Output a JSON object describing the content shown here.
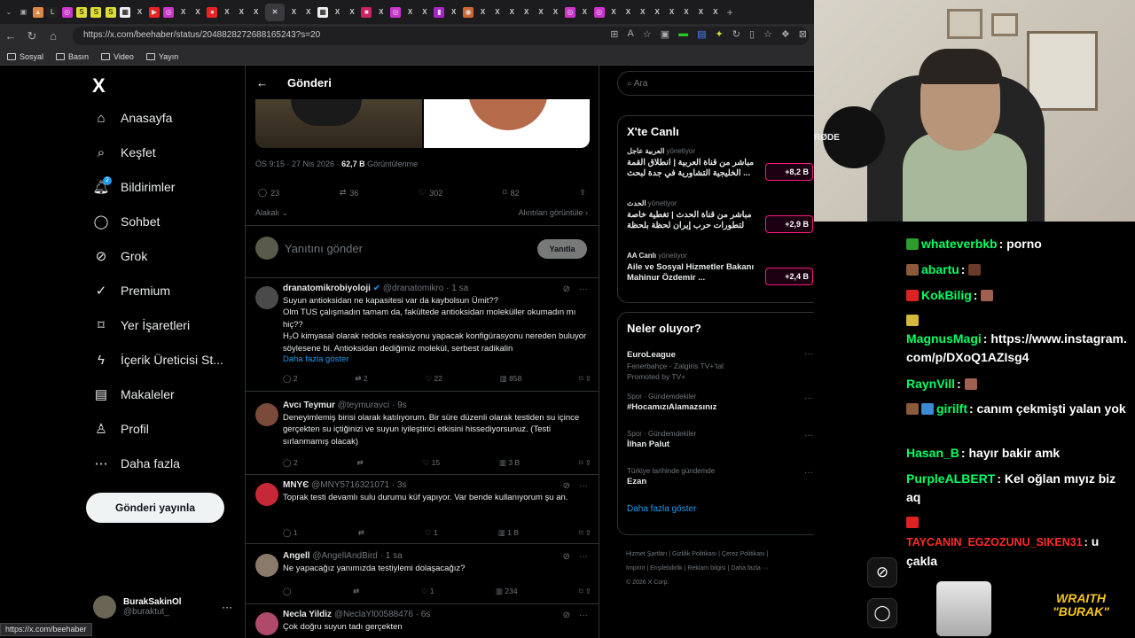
{
  "browser": {
    "url_host": "https://x.com",
    "url_path": "/beehaber/status/2048828272688165243?s=20",
    "bookmarks": [
      "Sosyal",
      "Basın",
      "Video",
      "Yayın"
    ],
    "status_url": "https://x.com/beehaber"
  },
  "nav": {
    "logo": "X",
    "items": [
      {
        "label": "Anasayfa",
        "icon": "home-icon"
      },
      {
        "label": "Keşfet",
        "icon": "search-icon"
      },
      {
        "label": "Bildirimler",
        "icon": "bell-icon",
        "badge": "2"
      },
      {
        "label": "Sohbet",
        "icon": "chat-icon"
      },
      {
        "label": "Grok",
        "icon": "grok-icon"
      },
      {
        "label": "Premium",
        "icon": "premium-icon"
      },
      {
        "label": "Yer İşaretleri",
        "icon": "bookmark-icon"
      },
      {
        "label": "İçerik Üreticisi St...",
        "icon": "lightning-icon"
      },
      {
        "label": "Makaleler",
        "icon": "article-icon"
      },
      {
        "label": "Profil",
        "icon": "person-icon"
      },
      {
        "label": "Daha fazla",
        "icon": "more-circle-icon"
      }
    ],
    "post_button": "Gönderi yayınla",
    "profile": {
      "name": "BurakSakinOl",
      "handle": "@buraktut_"
    }
  },
  "main": {
    "header": "Gönderi",
    "meta_time": "ÖS 9:15 · 27 Nis 2026 · ",
    "meta_views_value": "62,7 B",
    "meta_views_label": " Görüntülenme",
    "actions": {
      "replies": "23",
      "reposts": "36",
      "likes": "302",
      "bookmarks": "82"
    },
    "sort": "Alakalı",
    "quotes_link": "Alıntıları görüntüle",
    "reply_placeholder": "Yanıtını gönder",
    "reply_button": "Yanıtla",
    "tweets": [
      {
        "name": "dranatomikrobiyoloji",
        "handle": "@dranatomikro · 1 sa",
        "text": "Suyun antioksidan ne kapasitesi var da kaybolsun Ümit??\nOlm TUS çalışmadın tamam da, fakültede antioksidan moleküller okumadın mı hiç??\nH₂O kimyasal olarak redoks reaksiyonu yapacak konfigürasyonu nereden buluyor söylesene bi. Antioksidan dediğimiz molekül, serbest radikalin",
        "more": "Daha fazla göster",
        "replies": "2",
        "reposts": "2",
        "likes": "22",
        "views": "858"
      },
      {
        "name": "Avcı Teymur",
        "handle": "@teymuravci · 9s",
        "text": "Deneyimlemiş birisi olarak katılıyorum. Bir süre düzenli olarak testiden su içince gerçekten su içtiğinizi ve suyun iyileştirici etkisini hissediyorsunuz. (Testi sırlanmamış olacak)",
        "more": "",
        "replies": "2",
        "reposts": "",
        "likes": "15",
        "views": "3 B"
      },
      {
        "name": "MNYЄ",
        "handle": "@MNY5716321071 · 3s",
        "text": "Toprak testi devamlı sulu durumu küf yapıyor.  Var bende kullanıyorum şu an.",
        "more": "",
        "replies": "1",
        "reposts": "",
        "likes": "1",
        "views": "1 B"
      },
      {
        "name": "Angell",
        "handle": "@AngellAndBird · 1 sa",
        "text": "Ne yapacağız yanımızda testiyle​mi dolaşacağız?",
        "more": "",
        "replies": "",
        "reposts": "",
        "likes": "1",
        "views": "234"
      },
      {
        "name": "Necla Yildiz",
        "handle": "@NeclaYl00588476 · 6s",
        "text": "Çok doğru  suyun tadı  gerçekten",
        "more": "",
        "replies": "",
        "reposts": "",
        "likes": "",
        "views": ""
      }
    ]
  },
  "right": {
    "search_placeholder": "Ara",
    "live_title": "X'te Canlı",
    "live": [
      {
        "host": "العربية عاجل",
        "status": "yönetiyor",
        "title": "مباشر من قناة العربية | انطلاق القمة الخليجية التشاورية في جدة لبحث ...",
        "count": "+8,2 B"
      },
      {
        "host": "الحدث",
        "status": "yönetiyor",
        "title": "مباشر من قناة الحدث | تغطية خاصة لتطورات حرب إيران لحظة بلحظة",
        "count": "+2,9 B"
      },
      {
        "host": "AA Canlı",
        "status": "yönetiyor",
        "title": "Aile ve Sosyal Hizmetler Bakanı Mahinur Özdemir ...",
        "count": "+2,4 B"
      }
    ],
    "trends_title": "Neler oluyor?",
    "trends": [
      {
        "category": "",
        "name": "EuroLeague",
        "sub": "Fenerbahçe - Zalgiris TV+'tal",
        "promo": "Promoted by TV+"
      },
      {
        "category": "Spor · Gündemdekiler",
        "name": "#HocamızıAlamazsınız",
        "sub": "",
        "promo": ""
      },
      {
        "category": "Spor · Gündemdekiler",
        "name": "İlhan Palut",
        "sub": "",
        "promo": ""
      },
      {
        "category": "Türkiye tarihinde gündemde",
        "name": "Ezan",
        "sub": "",
        "promo": ""
      }
    ],
    "show_more": "Daha fazla göster",
    "footer": [
      "Hizmet Şartları",
      "Gizlilik Politikası",
      "Çerez Politikası",
      "Imprint",
      "Erişilebilirlik",
      "Reklam bilgisi",
      "Daha fazla ···",
      "© 2026 X Corp."
    ]
  },
  "stream": {
    "cam_label": "RØDE",
    "chat": [
      {
        "user": "whateverbkb",
        "text": " porno",
        "color": "#00ff66",
        "badge": "#2a9d2a"
      },
      {
        "user": "abartu",
        "text": " ",
        "color": "#00ff66",
        "badge": "#8a5a3a"
      },
      {
        "user": "KokBilig",
        "text": " ",
        "color": "#00ff66",
        "badge": "#d22"
      },
      {
        "user": "MagnusMagi",
        "text": " https://www.instagram.com/p/DXoQ1AZIsg4",
        "color": "#00ff66",
        "badge": "#d4b83a"
      },
      {
        "user": "RaynVill",
        "text": " ",
        "color": "#00ff66",
        "badge": ""
      },
      {
        "user": "girilft",
        "text": " canım çekmişti yalan yok",
        "color": "#00ff66",
        "badge": "#3a8ad4"
      },
      {
        "user": "Hasan_B",
        "text": " hayır bakir amk",
        "color": "#00ff66",
        "badge": ""
      },
      {
        "user": "PurpleALBERT",
        "text": " Kel oğlan mıyız biz aq",
        "color": "#00ff66",
        "badge": ""
      },
      {
        "user": "TAYCANIN_EGZOZUNU_SIKEN31",
        "text": " u çakla",
        "color": "#ff2a2a",
        "badge": "#d22"
      }
    ],
    "brand": "WRAITH\n\"BURAK\""
  }
}
